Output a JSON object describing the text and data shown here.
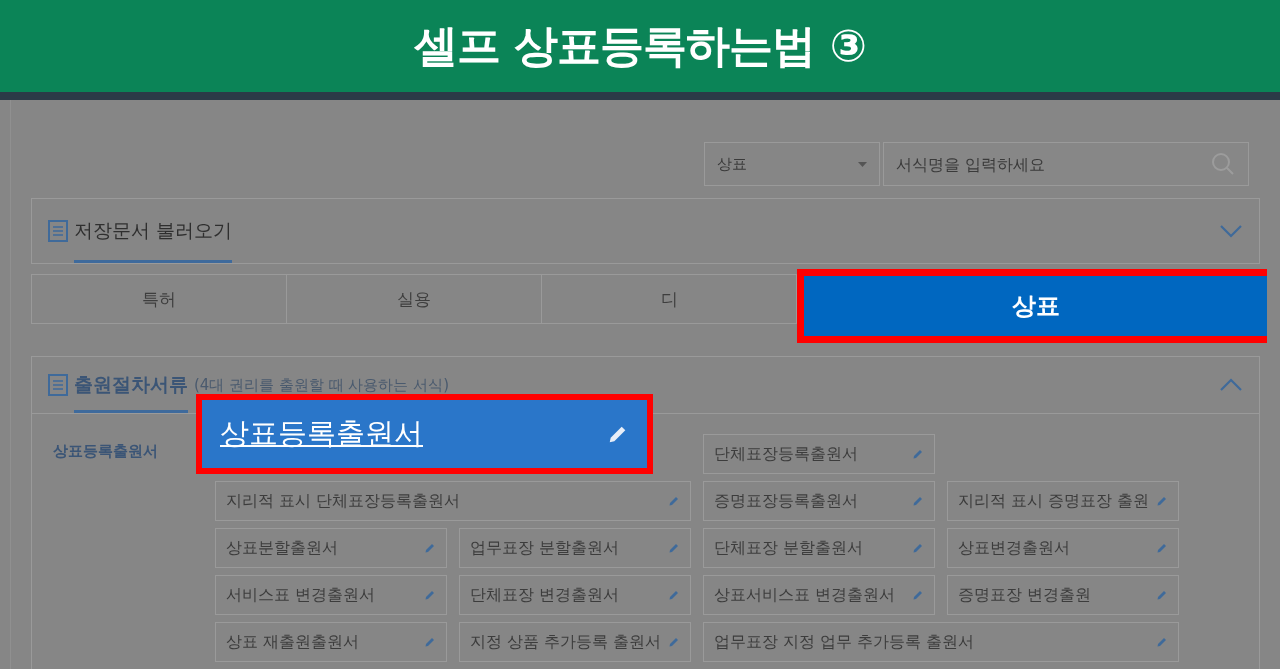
{
  "banner": {
    "title": "셀프 상표등록하는법 ③"
  },
  "search": {
    "category": "상표",
    "placeholder": "서식명을 입력하세요"
  },
  "saved_section": {
    "title": "저장문서 불러오기",
    "expanded": false
  },
  "tabs": [
    {
      "label": "특허",
      "selected": false
    },
    {
      "label": "실용",
      "selected": false
    },
    {
      "label": "디",
      "selected": false
    },
    {
      "label": "상표",
      "selected": true
    }
  ],
  "forms_section": {
    "title": "출원절차서류",
    "subtitle": "(4대 권리를 출원할 때 사용하는 서식)",
    "expanded": true,
    "side_label": "상표등록출원서",
    "items": [
      {
        "text": "상표등록출원서",
        "highlighted": true
      },
      {
        "text": "단체표장등록출원서",
        "wide": false,
        "highlighted": false
      },
      {
        "kind": "gap"
      },
      {
        "text": "지리적 표시 단체표장등록출원서",
        "wide": true,
        "highlighted": false
      },
      {
        "text": "증명표장등록출원서",
        "wide": false,
        "highlighted": false
      },
      {
        "text": "지리적 표시 증명표장 출원",
        "wide": false,
        "highlighted": false
      },
      {
        "text": "상표분할출원서",
        "wide": false,
        "highlighted": false
      },
      {
        "text": "업무표장 분할출원서",
        "wide": false,
        "highlighted": false
      },
      {
        "text": "단체표장 분할출원서",
        "wide": false,
        "highlighted": false
      },
      {
        "text": "상표변경출원서",
        "wide": false,
        "highlighted": false
      },
      {
        "text": "서비스표 변경출원서",
        "wide": false,
        "highlighted": false
      },
      {
        "text": "단체표장 변경출원서",
        "wide": false,
        "highlighted": false
      },
      {
        "text": "상표서비스표 변경출원서",
        "wide": false,
        "highlighted": false
      },
      {
        "text": "증명표장 변경출원",
        "wide": false,
        "highlighted": false
      },
      {
        "text": "상표 재출원출원서",
        "wide": false,
        "highlighted": false
      },
      {
        "text": "지정 상품 추가등록 출원서",
        "wide": false,
        "highlighted": false
      },
      {
        "text": "업무표장 지정 업무 추가등록 출원서",
        "wide": true,
        "highlighted": false
      }
    ]
  }
}
